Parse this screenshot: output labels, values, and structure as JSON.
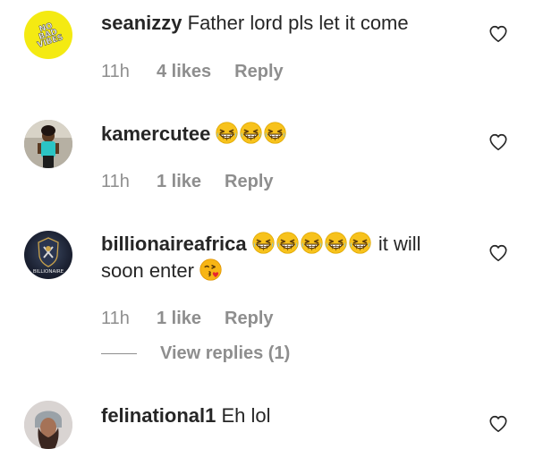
{
  "comments": [
    {
      "username": "seanizzy",
      "text": "Father lord pls let it come",
      "time": "11h",
      "likes": "4 likes",
      "reply": "Reply",
      "avatar_text": "NO BAD VIBES"
    },
    {
      "username": "kamercutee",
      "text": "",
      "emoji": [
        "grinning-squinting-face-emoji",
        "grinning-squinting-face-emoji",
        "grinning-squinting-face-emoji"
      ],
      "time": "11h",
      "likes": "1 like",
      "reply": "Reply"
    },
    {
      "username": "billionaireafrica",
      "text_after_emoji": "it will",
      "text_line2": "soon enter",
      "emoji": [
        "grinning-squinting-face-emoji",
        "grinning-squinting-face-emoji",
        "grinning-squinting-face-emoji",
        "grinning-squinting-face-emoji",
        "grinning-squinting-face-emoji"
      ],
      "trailing_emoji": "face-blowing-kiss-emoji",
      "time": "11h",
      "likes": "1 like",
      "reply": "Reply",
      "view_replies": "View replies (1)",
      "avatar_text": "BILLIONAIRE AFRICA"
    },
    {
      "username": "felinational1",
      "text": "Eh lol"
    }
  ],
  "colors": {
    "text": "#262626",
    "meta": "#8e8e8e",
    "emoji": "#f7c21c",
    "avatar_yellow": "#f4ea12"
  },
  "icons": {
    "like": "heart-outline-icon"
  }
}
